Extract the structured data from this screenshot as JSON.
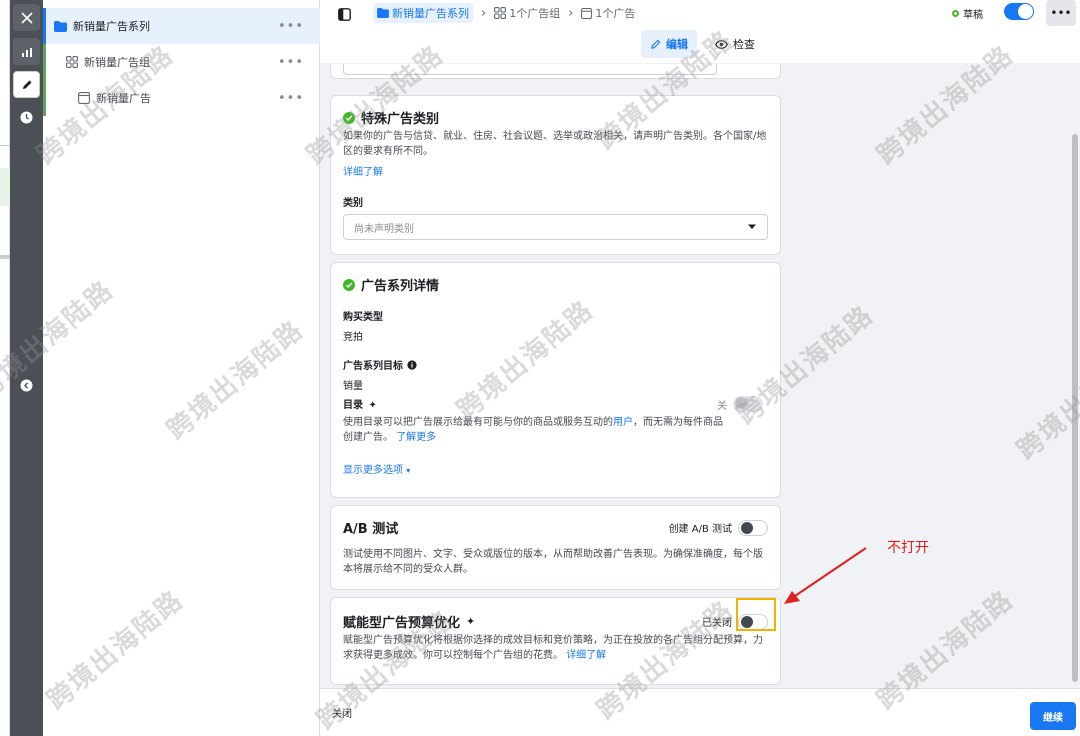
{
  "tree": {
    "campaign": "新销量广告系列",
    "adset": "新销量广告组",
    "ad": "新销量广告",
    "more": "•••"
  },
  "topbar": {
    "crumb_campaign": "新销量广告系列",
    "crumb_adset": "1个广告组",
    "crumb_ad": "1个广告",
    "status": "草稿",
    "more": "•••"
  },
  "modes": {
    "edit": "编辑",
    "review": "检查"
  },
  "special_category": {
    "title": "特殊广告类别",
    "desc": "如果你的广告与信贷、就业、住房、社会议题、选举或政治相关，请声明广告类别。各个国家/地区的要求有所不同。",
    "learn_more": "详细了解",
    "category_label": "类别",
    "category_placeholder": "尚未声明类别"
  },
  "campaign_details": {
    "title": "广告系列详情",
    "buy_type_label": "购买类型",
    "buy_type_value": "竞拍",
    "objective_label": "广告系列目标",
    "objective_value": "销量",
    "catalog_label": "目录",
    "catalog_state": "关",
    "catalog_desc_1": "使用目录可以把广告展示给最有可能与你的商品或服务互动的",
    "catalog_desc_link": "用户",
    "catalog_desc_2": "，而无需为每件商品创建广告。",
    "catalog_learn_more": "了解更多",
    "show_more": "显示更多选项"
  },
  "ab_test": {
    "title": "A/B 测试",
    "create_label": "创建 A/B 测试",
    "desc": "测试使用不同图片、文字、受众或版位的版本，从而帮助改善广告表现。为确保准确度，每个版本将展示给不同的受众人群。"
  },
  "advantage_budget": {
    "title": "赋能型广告预算优化",
    "state": "已关闭",
    "desc": "赋能型广告预算优化将根据你选择的成效目标和竞价策略，为正在投放的各广告组分配预算，力求获得更多成效。你可以控制每个广告组的花费。",
    "learn_more": "详细了解"
  },
  "footer": {
    "close": "关闭",
    "continue": "继续"
  },
  "annotation": {
    "text": "不打开"
  },
  "watermark": "跨境出海陆路",
  "colors": {
    "accent": "#1877f2",
    "success": "#42b72a",
    "annotation": "#e02020",
    "highlight": "#f0b400"
  }
}
